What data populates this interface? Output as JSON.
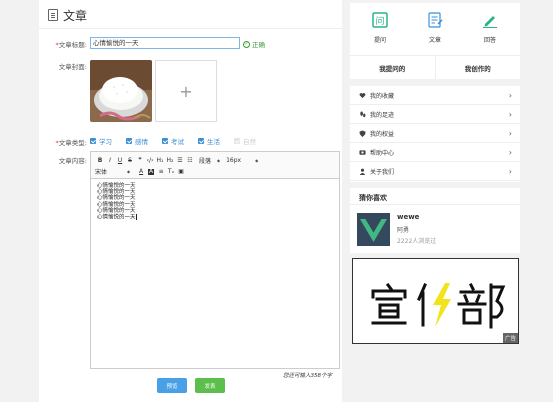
{
  "header": {
    "title": "文章"
  },
  "form": {
    "title_label": "文章标题:",
    "title_value": "心情愉悦的一天",
    "title_status": "正确",
    "cover_label": "文章封面:",
    "type_label": "文章类型:",
    "types": [
      {
        "label": "学习",
        "checked": true
      },
      {
        "label": "感情",
        "checked": true
      },
      {
        "label": "考试",
        "checked": true
      },
      {
        "label": "生活",
        "checked": true
      },
      {
        "label": "自然",
        "checked": false
      }
    ],
    "content_label": "文章内容:",
    "toolbar": {
      "heading_select": "段落",
      "size_select": "16px",
      "font_select": "宋体"
    },
    "content_lines": [
      "心情愉悦的一天",
      "心情愉悦的一天",
      "心情愉悦的一天",
      "心情愉悦的一天",
      "心情愉悦的一天",
      "心情愉悦的一天"
    ],
    "remaining": "您还可输入358个字",
    "preview_label": "预览",
    "publish_label": "发表"
  },
  "sidebar": {
    "quick": [
      {
        "label": "提问",
        "icon": "question-icon"
      },
      {
        "label": "文章",
        "icon": "article-icon"
      },
      {
        "label": "回答",
        "icon": "pen-icon"
      }
    ],
    "tabs": [
      "我提问的",
      "我创作的"
    ],
    "menu": [
      {
        "label": "我的收藏",
        "icon": "heart-icon"
      },
      {
        "label": "我的足迹",
        "icon": "footprint-icon"
      },
      {
        "label": "我的权益",
        "icon": "shield-icon"
      },
      {
        "label": "帮助中心",
        "icon": "help-icon"
      },
      {
        "label": "关于我们",
        "icon": "user-icon"
      }
    ],
    "guess": {
      "title": "猜你喜欢",
      "item": {
        "name": "wewe",
        "author": "阿勇",
        "views": "2222人浏览过"
      }
    },
    "ad": {
      "tag": "广告",
      "text": "宣传部"
    }
  },
  "colors": {
    "accent": "#3b8fd6",
    "success": "#3a9a3a",
    "icon_green": "#2bb38a",
    "preview": "#4aa0e6",
    "publish": "#5cbf4c"
  }
}
